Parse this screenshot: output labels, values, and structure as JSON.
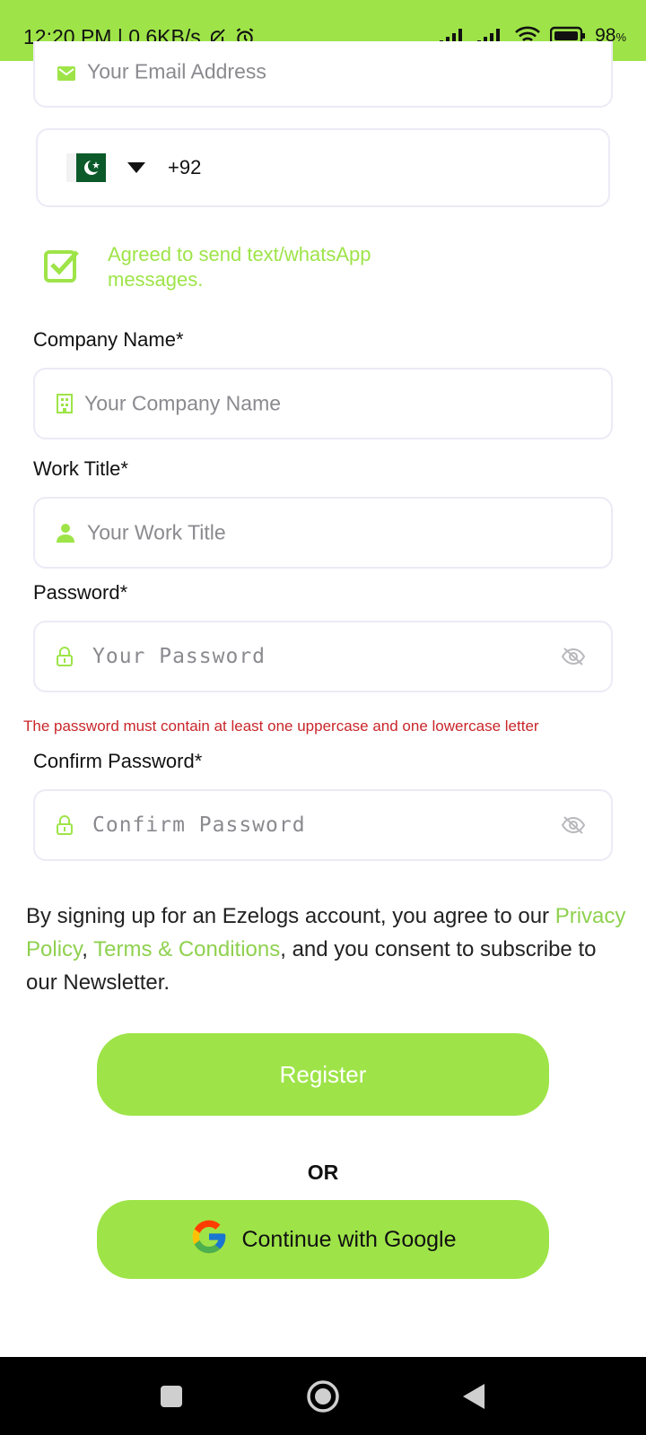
{
  "status_bar": {
    "time_speed": "12:20 PM | 0.6KB/s",
    "battery": "98",
    "battery_unit": "%"
  },
  "form": {
    "email_placeholder": "Your Email Address",
    "phone_code": "+92",
    "agree_text": "Agreed to send text/whatsApp messages.",
    "company_label": "Company Name*",
    "company_placeholder": "Your Company Name",
    "work_title_label": "Work Title*",
    "work_title_placeholder": "Your Work Title",
    "password_label": "Password*",
    "password_placeholder": "Your Password",
    "password_error": "The password must contain at least one uppercase and one lowercase letter",
    "confirm_label": "Confirm Password*",
    "confirm_placeholder": "Confirm Password"
  },
  "legal": {
    "prefix": "By signing up for an Ezelogs account, you agree to our ",
    "privacy": "Privacy Policy",
    "comma": ", ",
    "terms": "Terms & Conditions",
    "suffix": ", and you consent to subscribe to our Newsletter."
  },
  "actions": {
    "register": "Register",
    "or": "OR",
    "google": "Continue with Google"
  },
  "colors": {
    "accent": "#9ee448",
    "error": "#c9262a",
    "link": "#8fd14f"
  }
}
